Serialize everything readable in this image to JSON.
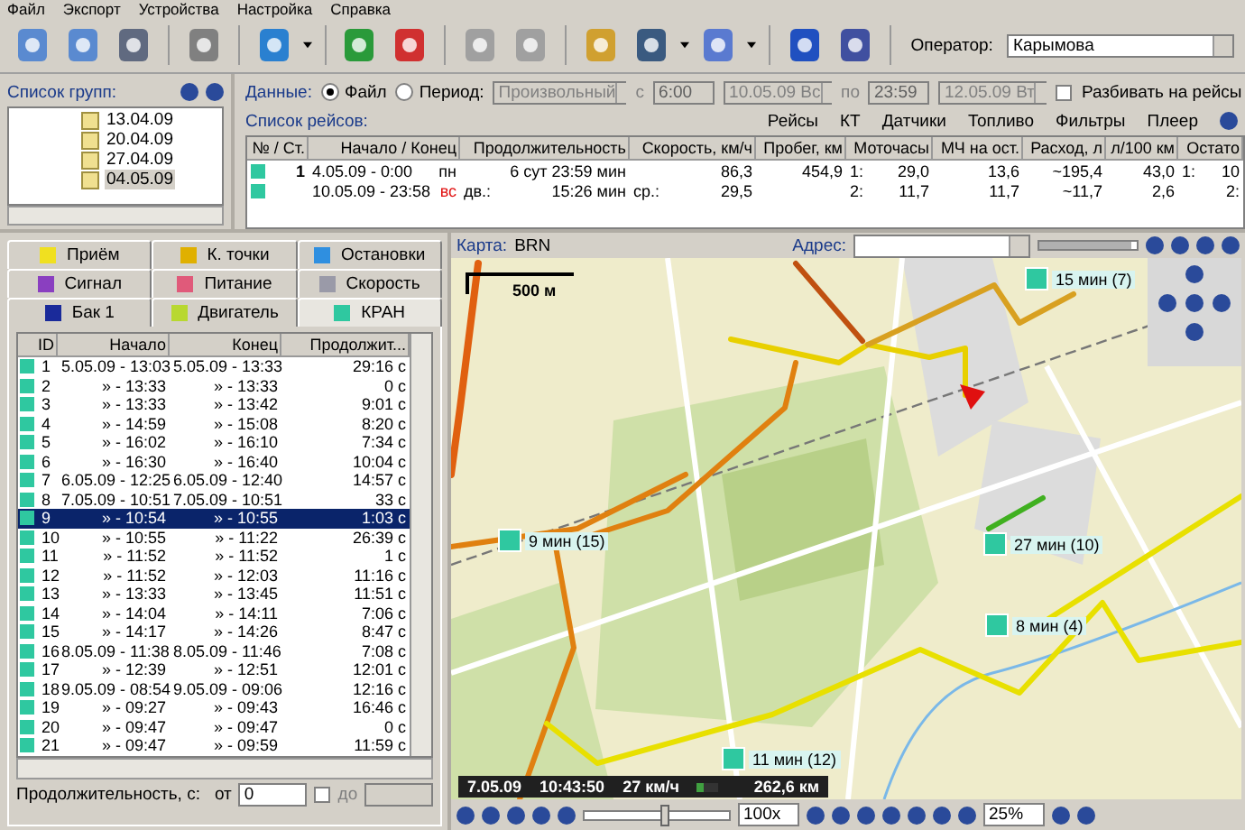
{
  "menu": [
    "Файл",
    "Экспорт",
    "Устройства",
    "Настройка",
    "Справка"
  ],
  "toolbar": {
    "operator_label": "Оператор:",
    "operator_value": "Карымова"
  },
  "groups": {
    "title": "Список групп:",
    "items": [
      {
        "label": "13.04.09",
        "selected": false
      },
      {
        "label": "20.04.09",
        "selected": false
      },
      {
        "label": "27.04.09",
        "selected": false
      },
      {
        "label": "04.05.09",
        "selected": true
      }
    ]
  },
  "data_filter": {
    "label": "Данные:",
    "sources": [
      {
        "label": "Файл",
        "selected": true
      },
      {
        "label": "Период:",
        "selected": false
      }
    ],
    "period": "Произвольный",
    "from_label": "с",
    "from_time": "6:00",
    "from_date": "10.05.09 Вс",
    "to_label": "по",
    "to_time": "23:59",
    "to_date": "12.05.09 Вт",
    "split": {
      "label": "Разбивать на рейсы",
      "checked": false
    }
  },
  "trips": {
    "title": "Список рейсов:",
    "links": [
      "Рейсы",
      "КТ",
      "Датчики",
      "Топливо",
      "Фильтры",
      "Плеер"
    ],
    "columns": [
      "№ / Ст.",
      "Начало / Конец",
      "Продолжительность",
      "Скорость, км/ч",
      "Пробег, км",
      "Моточасы",
      "МЧ на ост.",
      "Расход, л",
      "л/100 км",
      "Остато"
    ],
    "rows": [
      {
        "weekend": false,
        "cells": [
          [
            "1"
          ],
          [
            "4.05.09  -  0:00",
            "пн"
          ],
          [
            "6 сут 23:59 мин"
          ],
          [
            "86,3"
          ],
          [
            "454,9"
          ],
          [
            "1:",
            "29,0"
          ],
          [
            "13,6"
          ],
          [
            "~195,4"
          ],
          [
            "43,0"
          ],
          [
            "1:",
            "10"
          ]
        ]
      },
      {
        "weekend": true,
        "cells": [
          null,
          [
            "10.05.09  -  23:58",
            "вс"
          ],
          [
            "дв.:",
            "15:26 мин"
          ],
          [
            "ср.:",
            "29,5"
          ],
          null,
          [
            "2:",
            "11,7"
          ],
          [
            "11,7"
          ],
          [
            "~11,7"
          ],
          [
            "2,6"
          ],
          [
            "2:"
          ]
        ]
      }
    ]
  },
  "tab_rows": [
    [
      {
        "label": "Приём",
        "color": "#f0e020",
        "selected": false
      },
      {
        "label": "К. точки",
        "color": "#e0b000",
        "selected": false
      },
      {
        "label": "Остановки",
        "color": "#2f8fe0",
        "selected": false
      }
    ],
    [
      {
        "label": "Сигнал",
        "color": "#8a3fc0",
        "selected": false
      },
      {
        "label": "Питание",
        "color": "#e05a7a",
        "selected": false
      },
      {
        "label": "Скорость",
        "color": "#9a9aa8",
        "selected": false
      }
    ],
    [
      {
        "label": "Бак 1",
        "color": "#1a2a9a",
        "selected": false
      },
      {
        "label": "Двигатель",
        "color": "#b8d830",
        "selected": false
      },
      {
        "label": "КРАН",
        "color": "#2fc8a0",
        "selected": true
      }
    ]
  ],
  "events": {
    "columns": [
      "ID",
      "Начало",
      "Конец",
      "Продолжит..."
    ],
    "rows": [
      {
        "id": "1",
        "start": "5.05.09 - 13:03",
        "end": "5.05.09 - 13:33",
        "duration": "29:16 с",
        "selected": false
      },
      {
        "id": "2",
        "start": "» - 13:33",
        "end": "» - 13:33",
        "duration": "0 с",
        "selected": false
      },
      {
        "id": "3",
        "start": "» - 13:33",
        "end": "» - 13:42",
        "duration": "9:01 с",
        "selected": false
      },
      {
        "id": "4",
        "start": "» - 14:59",
        "end": "» - 15:08",
        "duration": "8:20 с",
        "selected": false
      },
      {
        "id": "5",
        "start": "» - 16:02",
        "end": "» - 16:10",
        "duration": "7:34 с",
        "selected": false
      },
      {
        "id": "6",
        "start": "» - 16:30",
        "end": "» - 16:40",
        "duration": "10:04 с",
        "selected": false
      },
      {
        "id": "7",
        "start": "6.05.09 - 12:25",
        "end": "6.05.09 - 12:40",
        "duration": "14:57 с",
        "selected": false
      },
      {
        "id": "8",
        "start": "7.05.09 - 10:51",
        "end": "7.05.09 - 10:51",
        "duration": "33 с",
        "selected": false
      },
      {
        "id": "9",
        "start": "» - 10:54",
        "end": "» - 10:55",
        "duration": "1:03 с",
        "selected": true
      },
      {
        "id": "10",
        "start": "» - 10:55",
        "end": "» - 11:22",
        "duration": "26:39 с",
        "selected": false
      },
      {
        "id": "11",
        "start": "» - 11:52",
        "end": "» - 11:52",
        "duration": "1 с",
        "selected": false
      },
      {
        "id": "12",
        "start": "» - 11:52",
        "end": "» - 12:03",
        "duration": "11:16 с",
        "selected": false
      },
      {
        "id": "13",
        "start": "» - 13:33",
        "end": "» - 13:45",
        "duration": "11:51 с",
        "selected": false
      },
      {
        "id": "14",
        "start": "» - 14:04",
        "end": "» - 14:11",
        "duration": "7:06 с",
        "selected": false
      },
      {
        "id": "15",
        "start": "» - 14:17",
        "end": "» - 14:26",
        "duration": "8:47 с",
        "selected": false
      },
      {
        "id": "16",
        "start": "8.05.09 - 11:38",
        "end": "8.05.09 - 11:46",
        "duration": "7:08 с",
        "selected": false
      },
      {
        "id": "17",
        "start": "» - 12:39",
        "end": "» - 12:51",
        "duration": "12:01 с",
        "selected": false
      },
      {
        "id": "18",
        "start": "9.05.09 - 08:54",
        "end": "9.05.09 - 09:06",
        "duration": "12:16 с",
        "selected": false
      },
      {
        "id": "19",
        "start": "» - 09:27",
        "end": "» - 09:43",
        "duration": "16:46 с",
        "selected": false
      },
      {
        "id": "20",
        "start": "» - 09:47",
        "end": "» - 09:47",
        "duration": "0 с",
        "selected": false
      },
      {
        "id": "21",
        "start": "» - 09:47",
        "end": "» - 09:59",
        "duration": "11:59 с",
        "selected": false
      }
    ]
  },
  "duration_filter": {
    "label": "Продолжительность, с:",
    "from_label": "от",
    "from_value": "0",
    "to_label": "до",
    "to_checked": false,
    "to_disabled": true
  },
  "map": {
    "label": "Карта:",
    "name": "BRN",
    "address_label": "Адрес:",
    "zoom_slider": {
      "level": 0.95
    },
    "scale": "500 м",
    "markers": [
      {
        "label": "15 мин (7)"
      },
      {
        "label": "9 мин (15)"
      },
      {
        "label": "27 мин (10)"
      },
      {
        "label": "8 мин (4)"
      },
      {
        "label": "11 мин (12)"
      }
    ],
    "status": {
      "date": "7.05.09",
      "time": "10:43:50",
      "speed": "27 км/ч",
      "level": 0.3,
      "distance": "262,6 км"
    },
    "player": {
      "position": {
        "level": 0.52
      },
      "speed": "100x",
      "zoom": "25%"
    }
  }
}
